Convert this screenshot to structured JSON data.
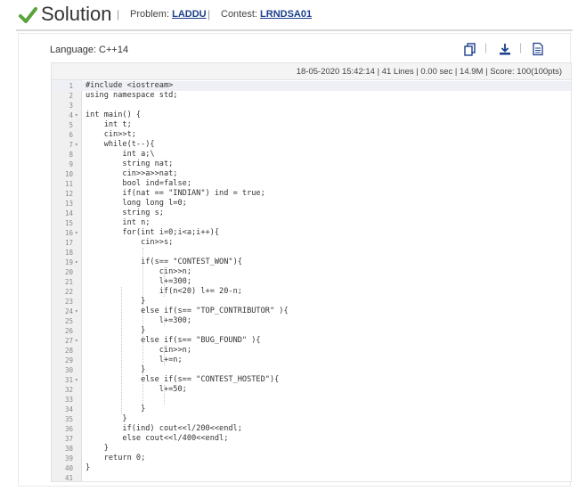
{
  "header": {
    "title": "Solution",
    "problem_label": "Problem:",
    "problem_code": "LADDU",
    "contest_label": "Contest:",
    "contest_code": "LRNDSA01",
    "check_color": "#5aa33c"
  },
  "panel": {
    "language": "Language: C++14",
    "toolbar_icons": [
      "copy-icon",
      "download-icon",
      "open-file-icon"
    ]
  },
  "status": {
    "datetime": "18-05-2020 15:42:14",
    "lines": "41 Lines",
    "time": "0.00 sec",
    "memory": "14.9M",
    "score": "Score: 100(100pts)"
  },
  "code": {
    "lines": [
      "#include <iostream>",
      "using namespace std;",
      "",
      "int main() {",
      "    int t;",
      "    cin>>t;",
      "    while(t--){",
      "        int a;\\",
      "        string nat;",
      "        cin>>a>>nat;",
      "        bool ind=false;",
      "        if(nat == \"INDIAN\") ind = true;",
      "        long long l=0;",
      "        string s;",
      "        int n;",
      "        for(int i=0;i<a;i++){",
      "            cin>>s;",
      "",
      "            if(s== \"CONTEST_WON\"){",
      "                cin>>n;",
      "                l+=300;",
      "                if(n<20) l+= 20-n;",
      "            }",
      "            else if(s== \"TOP_CONTRIBUTOR\" ){",
      "                l+=300;",
      "            }",
      "            else if(s== \"BUG_FOUND\" ){",
      "                cin>>n;",
      "                l+=n;",
      "            }",
      "            else if(s== \"CONTEST_HOSTED\"){",
      "                l+=50;",
      "",
      "            }",
      "        }",
      "        if(ind) cout<<l/200<<endl;",
      "        else cout<<l/400<<endl;",
      "    }",
      "    return 0;",
      "}",
      ""
    ],
    "folds": [
      4,
      7,
      16,
      19,
      24,
      27,
      31
    ],
    "active_line": 1
  }
}
